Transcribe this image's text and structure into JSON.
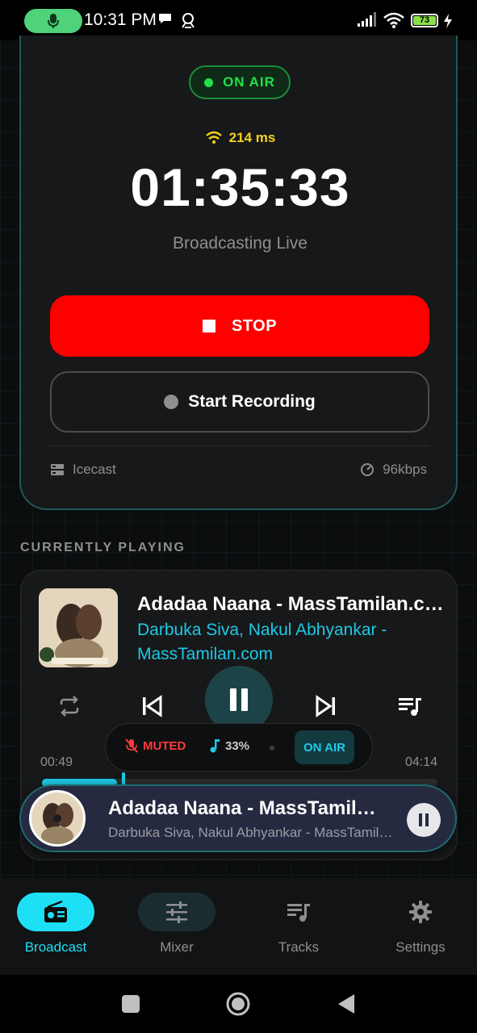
{
  "statusbar": {
    "time": "10:31 PM",
    "battery": "73"
  },
  "broadcast": {
    "status_pill": "ON AIR",
    "latency": "214 ms",
    "timer": "01:35:33",
    "subtitle": "Broadcasting Live",
    "stop_label": "STOP",
    "record_label": "Start Recording",
    "server": "Icecast",
    "bitrate": "96kbps"
  },
  "now_playing": {
    "section_title": "CURRENTLY PLAYING",
    "title": "Adadaa Naana - MassTamilan.com",
    "artist": "Darbuka Siva, Nakul Abhyankar - MassTamilan.com",
    "muted_label": "MUTED",
    "volume": "33%",
    "onair_label": "ON AIR",
    "elapsed": "00:49",
    "duration": "04:14",
    "progress_fraction": 0.19
  },
  "mini_player": {
    "title": "Adadaa Naana - MassTamilan.com",
    "artist": "Darbuka Siva, Nakul Abhyankar - MassTamilan.com"
  },
  "nav": {
    "items": [
      {
        "label": "Broadcast",
        "icon": "radio-icon",
        "active": true
      },
      {
        "label": "Mixer",
        "icon": "sliders-icon",
        "active": false
      },
      {
        "label": "Tracks",
        "icon": "queue-music-icon",
        "active": false
      },
      {
        "label": "Settings",
        "icon": "gear-icon",
        "active": false
      }
    ]
  },
  "colors": {
    "accent": "#1ec9e6",
    "stop": "#ff0000",
    "onair_green": "#22e048",
    "latency_yellow": "#f5d21a",
    "muted_red": "#ff3b3b"
  }
}
